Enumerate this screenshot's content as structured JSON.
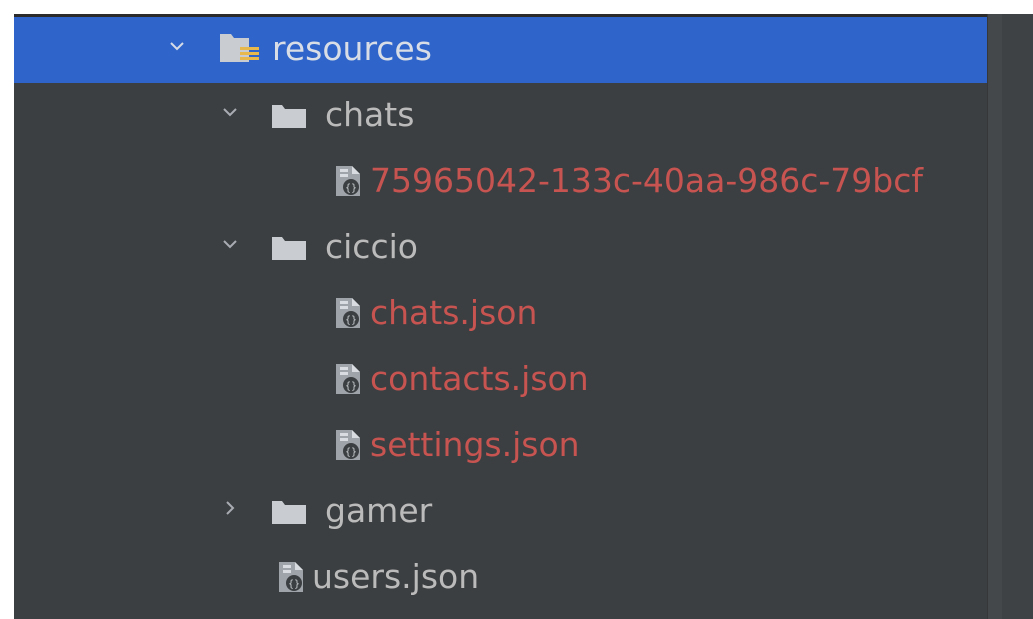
{
  "tree": {
    "items": [
      {
        "label": "resources",
        "icon": "resources-folder-icon",
        "expanded": true,
        "selected": true
      },
      {
        "label": "chats",
        "icon": "folder-icon",
        "expanded": true
      },
      {
        "label": "75965042-133c-40aa-986c-79bcf",
        "icon": "json-file-icon",
        "status": "unversioned"
      },
      {
        "label": "ciccio",
        "icon": "folder-icon",
        "expanded": true
      },
      {
        "label": "chats.json",
        "icon": "json-file-icon",
        "status": "unversioned"
      },
      {
        "label": "contacts.json",
        "icon": "json-file-icon",
        "status": "unversioned"
      },
      {
        "label": "settings.json",
        "icon": "json-file-icon",
        "status": "unversioned"
      },
      {
        "label": "gamer",
        "icon": "folder-icon",
        "expanded": false
      },
      {
        "label": "users.json",
        "icon": "json-file-icon"
      }
    ]
  },
  "colors": {
    "panel_bg": "#3c3f41",
    "selection": "#2f65ca",
    "text_default": "#bbbbbb",
    "text_unversioned": "#c75450",
    "folder": "#c9cdd1"
  }
}
